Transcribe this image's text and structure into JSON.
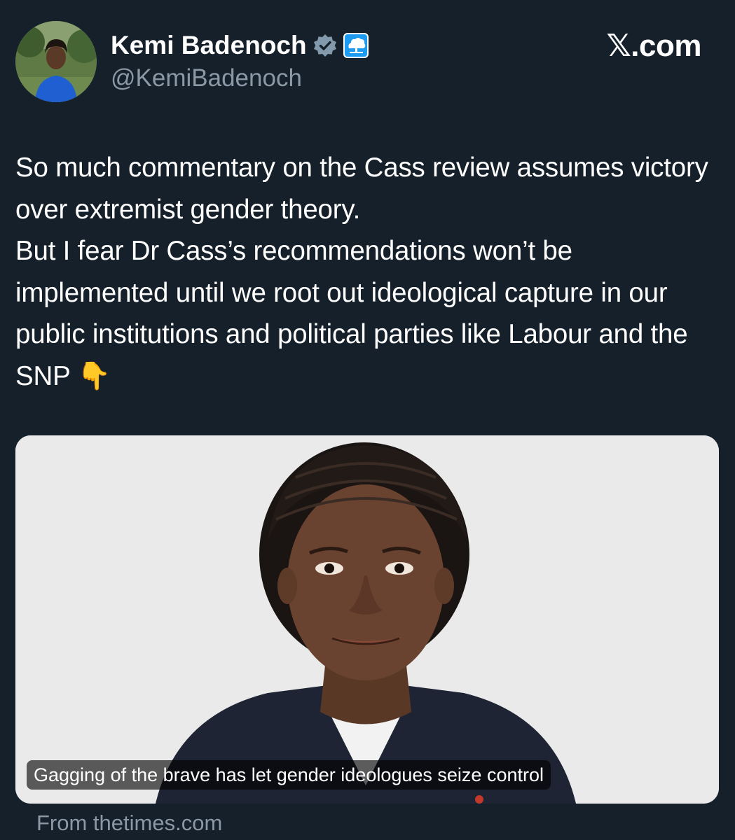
{
  "profile": {
    "display_name": "Kemi Badenoch",
    "handle": "@KemiBadenoch",
    "verified_icon": "verified-badge-icon",
    "affiliate_icon": "conservative-party-tree-icon"
  },
  "brand": {
    "label": "𝕏.com"
  },
  "tweet": {
    "text": "So much commentary on the Cass review assumes victory over extremist gender theory.\nBut I fear Dr Cass’s recommendations won’t be implemented until we root out ideological capture in our public institutions and political parties like Labour and the SNP 👇"
  },
  "link_card": {
    "caption": "Gagging of the brave has let gender ideologues seize control",
    "source": "From thetimes.com"
  },
  "colors": {
    "background": "#15202b",
    "secondary_text": "#8b98a5",
    "verified_gray": "#829aab",
    "affiliate_blue": "#1d9bf0"
  }
}
